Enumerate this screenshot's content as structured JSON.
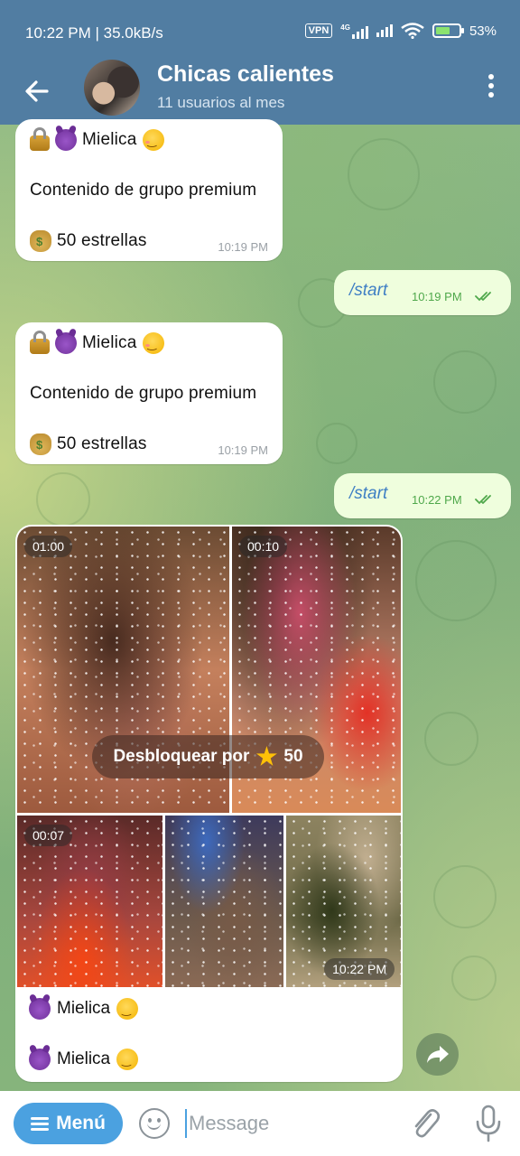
{
  "status_bar": {
    "time_speed": "10:22 PM | 35.0kB/s",
    "vpn": "VPN",
    "network": "4G",
    "battery": "53%"
  },
  "header": {
    "title": "Chicas calientes",
    "subtitle": "11 usuarios al mes",
    "back_icon": "arrow-left-icon",
    "menu_icon": "more-vertical-icon"
  },
  "messages": [
    {
      "type": "incoming",
      "line1": "Mielica",
      "line2": "Contenido de grupo premium",
      "line3": "50 estrellas",
      "time": "10:19 PM"
    },
    {
      "type": "outgoing",
      "text": "/start",
      "time": "10:19 PM"
    },
    {
      "type": "incoming",
      "line1": "Mielica",
      "line2": "Contenido de grupo premium",
      "line3": "50 estrellas",
      "time": "10:19 PM"
    },
    {
      "type": "outgoing",
      "text": "/start",
      "time": "10:22 PM"
    }
  ],
  "album": {
    "durations": [
      "01:00",
      "00:10",
      "00:07"
    ],
    "unlock_label": "Desbloquear por",
    "unlock_amount": "50",
    "time": "10:22 PM",
    "caption_line1": "Mielica",
    "caption_line2": "Mielica"
  },
  "input_bar": {
    "menu_label": "Menú",
    "placeholder": "Message"
  },
  "colors": {
    "header": "#517da2",
    "outgoing_bubble": "#effedd",
    "command_link": "#3f7fc4",
    "menu_button": "#4ba1e0",
    "read_ticks": "#4fa84b"
  }
}
